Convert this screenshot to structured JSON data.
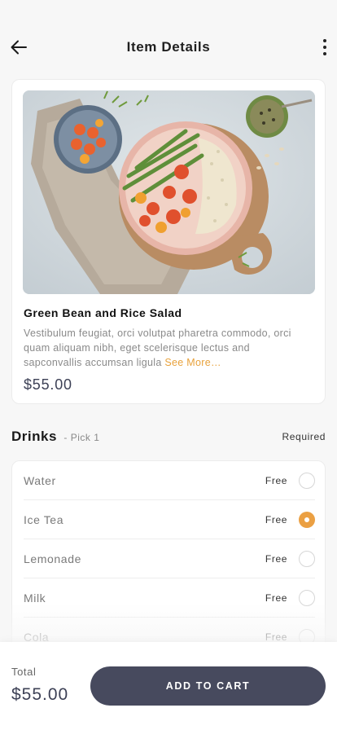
{
  "header": {
    "title": "Item Details",
    "back_icon": "arrow-left-icon",
    "more_icon": "more-vertical-icon"
  },
  "item": {
    "name": "Green Bean and Rice Salad",
    "description": "Vestibulum feugiat, orci volutpat pharetra commodo, orci quam aliquam nibh, eget scelerisque lectus and sapconvallis accumsan ligula",
    "see_more": "See More…",
    "price": "$55.00"
  },
  "drinks": {
    "title": "Drinks",
    "subtitle": "- Pick 1",
    "required": "Required",
    "options": [
      {
        "name": "Water",
        "price": "Free",
        "selected": false
      },
      {
        "name": "Ice Tea",
        "price": "Free",
        "selected": true
      },
      {
        "name": "Lemonade",
        "price": "Free",
        "selected": false
      },
      {
        "name": "Milk",
        "price": "Free",
        "selected": false
      },
      {
        "name": "Cola",
        "price": "Free",
        "selected": false
      }
    ]
  },
  "footer": {
    "total_label": "Total",
    "total_value": "$55.00",
    "add_to_cart": "ADD TO CART"
  },
  "colors": {
    "accent": "#eba043",
    "primary_button": "#474a5e",
    "price_text": "#3d4156"
  }
}
